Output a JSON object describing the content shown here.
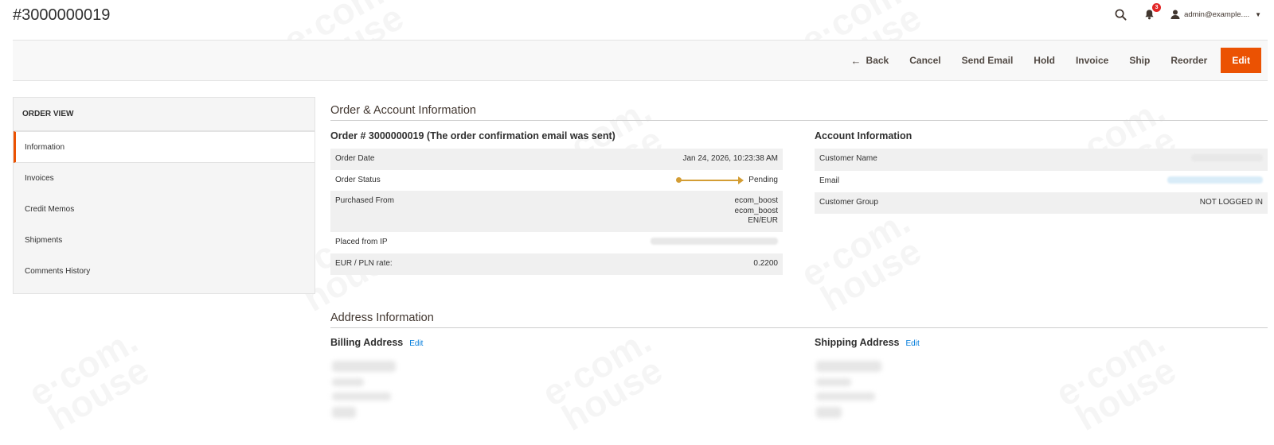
{
  "header": {
    "title": "#3000000019",
    "notification_count": "3",
    "admin_user": "admin@example....",
    "icons": {
      "search": "search-icon",
      "notifications": "bell-icon",
      "user": "user-icon"
    }
  },
  "actions": {
    "back": "Back",
    "cancel": "Cancel",
    "send_email": "Send Email",
    "hold": "Hold",
    "invoice": "Invoice",
    "ship": "Ship",
    "reorder": "Reorder",
    "edit": "Edit"
  },
  "sidebar": {
    "title": "ORDER VIEW",
    "items": [
      {
        "label": "Information",
        "active": true
      },
      {
        "label": "Invoices"
      },
      {
        "label": "Credit Memos"
      },
      {
        "label": "Shipments"
      },
      {
        "label": "Comments History"
      }
    ]
  },
  "order_account": {
    "section_title": "Order & Account Information",
    "order": {
      "title": "Order # 3000000019 (The order confirmation email was sent)",
      "rows": {
        "order_date_label": "Order Date",
        "order_date_value": "Jan 24, 2026, 10:23:38 AM",
        "status_label": "Order Status",
        "status_value": "Pending",
        "purchased_label": "Purchased From",
        "purchased_line1": "ecom_boost",
        "purchased_line2": "ecom_boost",
        "purchased_line3": "EN/EUR",
        "ip_label": "Placed from IP",
        "rate_label": "EUR / PLN rate:",
        "rate_value": "0.2200"
      }
    },
    "account": {
      "title": "Account Information",
      "rows": {
        "name_label": "Customer Name",
        "email_label": "Email",
        "group_label": "Customer Group",
        "group_value": "NOT LOGGED IN"
      }
    }
  },
  "address": {
    "section_title": "Address Information",
    "billing_title": "Billing Address",
    "shipping_title": "Shipping Address",
    "edit_label": "Edit"
  },
  "colors": {
    "accent": "#eb5202",
    "link": "#007bdb",
    "status": "#d39d34",
    "badge": "#e22626"
  }
}
